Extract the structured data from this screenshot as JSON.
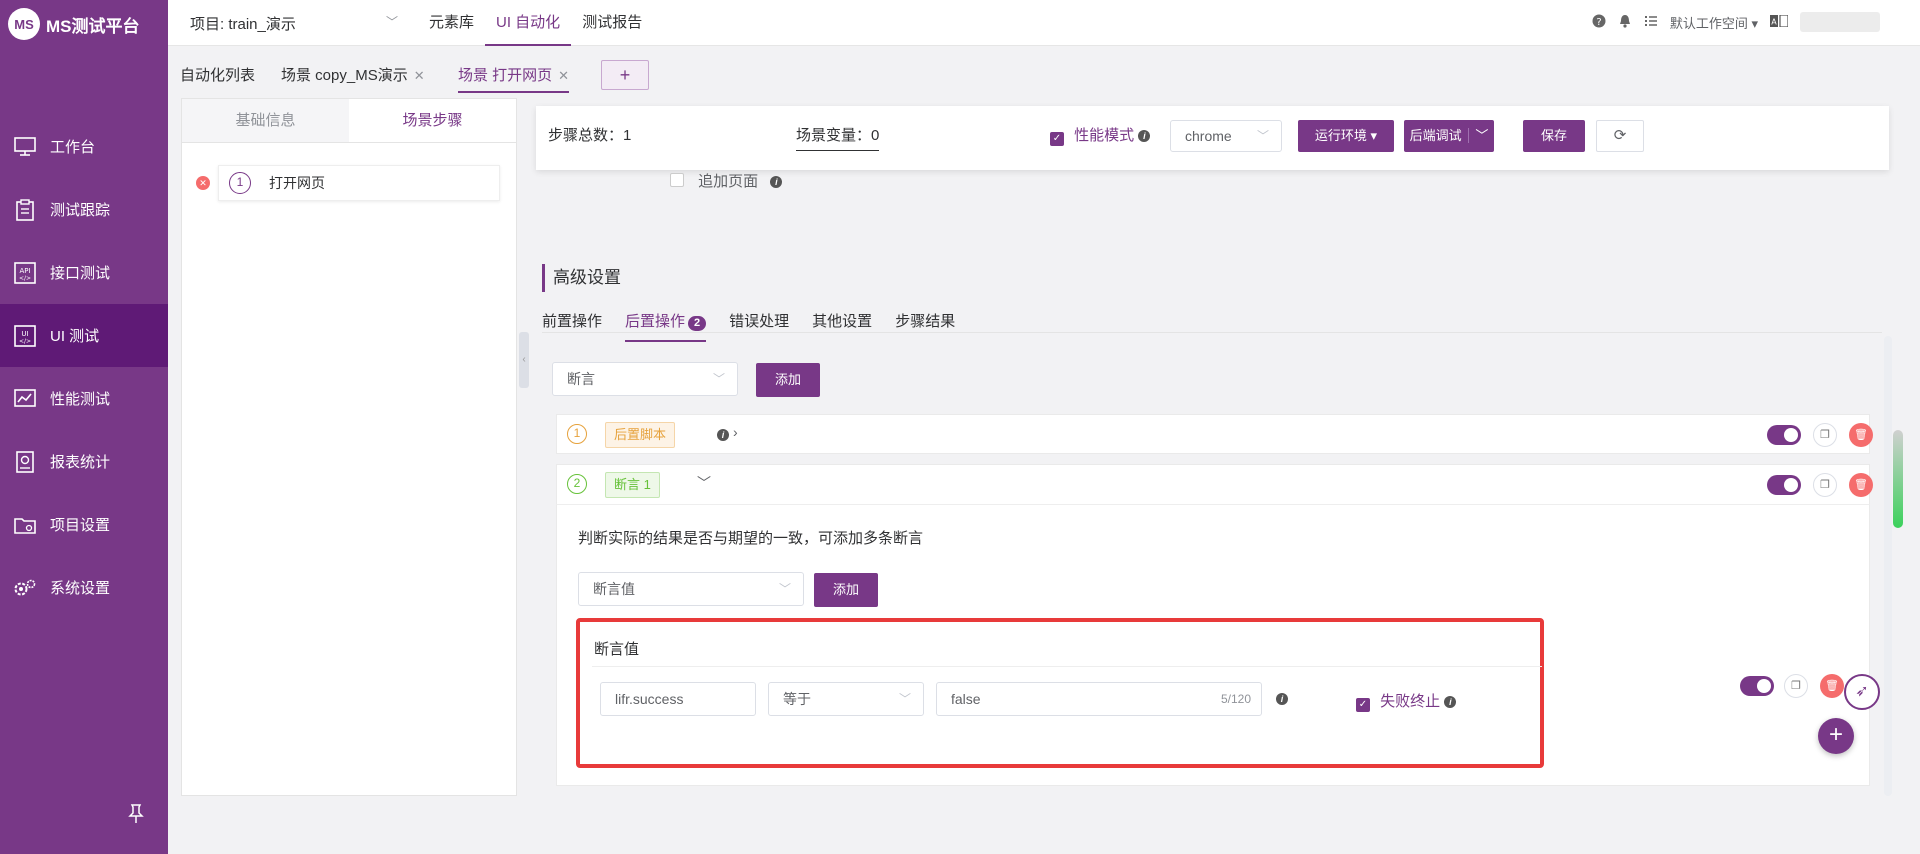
{
  "app": {
    "logo_mark": "MS",
    "logo_text": "MS测试平台"
  },
  "sidebar": {
    "items": [
      {
        "label": "工作台",
        "icon": "monitor-icon",
        "active": false
      },
      {
        "label": "测试跟踪",
        "icon": "clipboard-icon",
        "active": false
      },
      {
        "label": "接口测试",
        "icon": "api-icon",
        "active": false
      },
      {
        "label": "UI 测试",
        "icon": "ui-icon",
        "active": true
      },
      {
        "label": "性能测试",
        "icon": "chart-icon",
        "active": false
      },
      {
        "label": "报表统计",
        "icon": "report-icon",
        "active": false
      },
      {
        "label": "项目设置",
        "icon": "folder-icon",
        "active": false
      },
      {
        "label": "系统设置",
        "icon": "gear-icon",
        "active": false
      }
    ]
  },
  "topbar": {
    "project": "项目: train_演示",
    "nav": [
      "元素库",
      "UI 自动化",
      "测试报告"
    ],
    "active_nav": 1,
    "workspace": "默认工作空间"
  },
  "tabs": {
    "list_label": "自动化列表",
    "items": [
      {
        "label": "场景 copy_MS演示",
        "active": false
      },
      {
        "label": "场景 打开网页",
        "active": true
      }
    ],
    "add": "+"
  },
  "left_panel": {
    "tabs": [
      "基础信息",
      "场景步骤"
    ],
    "active_tab": 1,
    "step": {
      "num": "1",
      "label": "打开网页"
    }
  },
  "header": {
    "step_total": "步骤总数：1",
    "scene_var": "场景变量：0",
    "perf_mode": "性能模式",
    "browser": "chrome",
    "run_env": "运行环境",
    "debug": "后端调试",
    "save": "保存"
  },
  "main": {
    "add_page": "追加页面",
    "adv_title": "高级设置",
    "subtabs": [
      "前置操作",
      "后置操作",
      "错误处理",
      "其他设置",
      "步骤结果"
    ],
    "active_subtab": 1,
    "subtab_badge": "2",
    "op_select": "断言",
    "add": "添加",
    "row1": {
      "num": "1",
      "tag": "后置脚本"
    },
    "row2": {
      "num": "2",
      "tag": "断言 1"
    },
    "desc": "判断实际的结果是否与期望的一致，可添加多条断言",
    "assert_select": "断言值",
    "assert_add": "添加",
    "assert_box": {
      "title": "断言值",
      "field": "lifr.success",
      "operator": "等于",
      "value": "false",
      "counter": "5/120",
      "fail_stop": "失败终止"
    }
  },
  "colors": {
    "brand": "#783887",
    "active_nav": "#5f1a76",
    "danger": "#f56c6c",
    "highlight": "#e83a3a"
  }
}
